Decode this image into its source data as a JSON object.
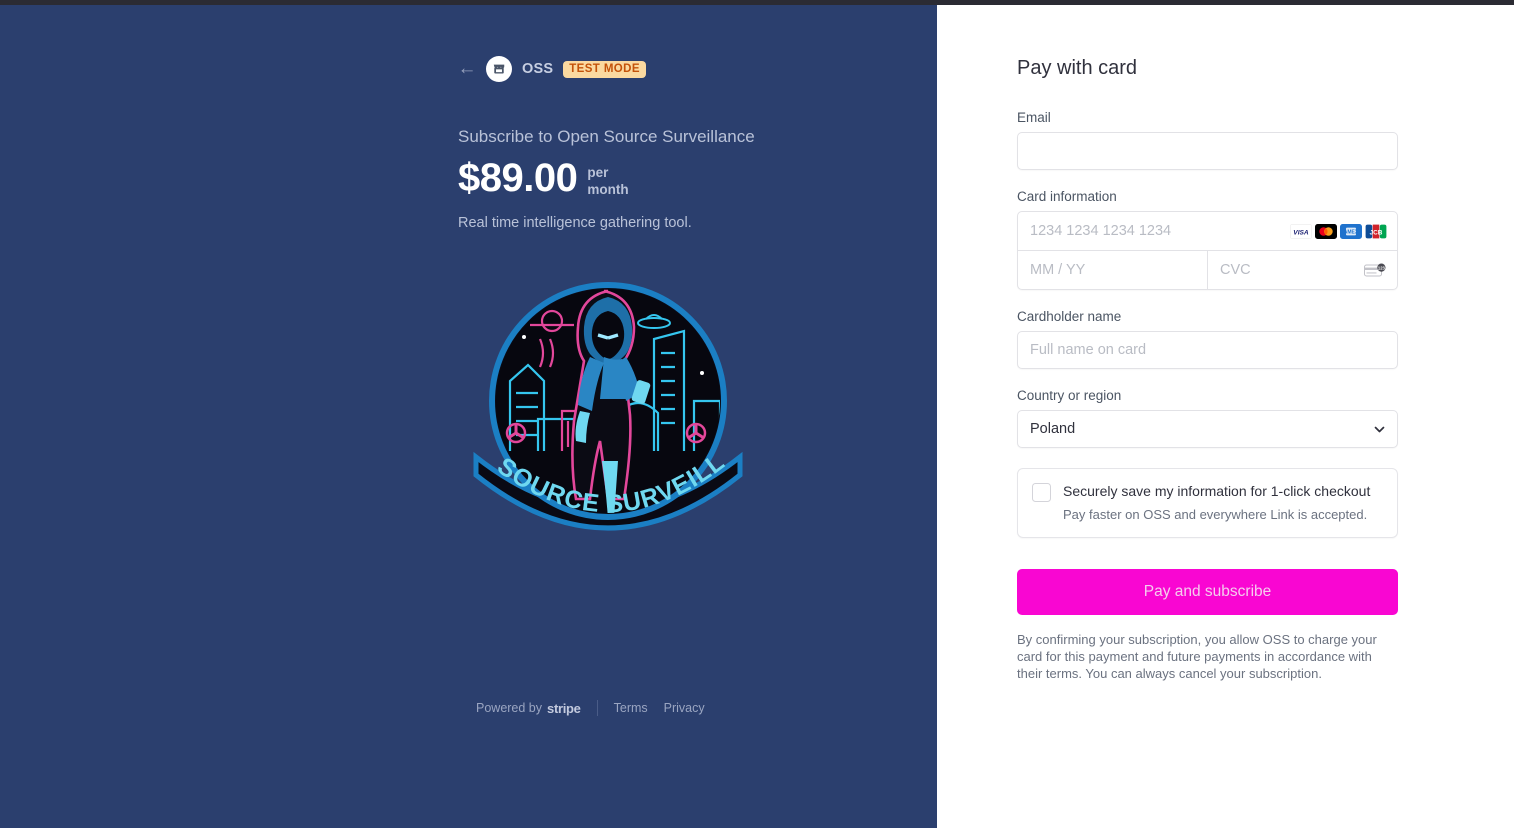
{
  "merchant": {
    "back_icon": "back-arrow-icon",
    "avatar_icon": "storefront-icon",
    "name": "OSS",
    "test_mode_badge": "TEST MODE"
  },
  "summary": {
    "subscribe_title": "Subscribe to Open Source Surveillance",
    "price": "$89.00",
    "interval_line1": "per",
    "interval_line2": "month",
    "description": "Real time intelligence gathering tool.",
    "logo_alt": "open-source-surveillance-badge",
    "logo_banner_text": "OPEN SOURCE SURVEILLANCE"
  },
  "footer": {
    "powered_by": "Powered by",
    "stripe": "stripe",
    "terms": "Terms",
    "privacy": "Privacy"
  },
  "form": {
    "title": "Pay with card",
    "email_label": "Email",
    "email_value": "",
    "email_placeholder": "",
    "card_label": "Card information",
    "card_number_placeholder": "1234 1234 1234 1234",
    "card_number_value": "",
    "expiry_placeholder": "MM / YY",
    "expiry_value": "",
    "cvc_placeholder": "CVC",
    "cvc_value": "",
    "brands": [
      "visa-icon",
      "mastercard-icon",
      "amex-icon",
      "jcb-icon"
    ],
    "cvc_hint_icon": "cvc-card-icon",
    "cardholder_label": "Cardholder name",
    "cardholder_placeholder": "Full name on card",
    "cardholder_value": "",
    "country_label": "Country or region",
    "country_value": "Poland",
    "country_options": [
      "Poland"
    ],
    "chevron_icon": "chevron-down-icon",
    "link_checkbox_checked": false,
    "link_title": "Securely save my information for 1-click checkout",
    "link_subtitle": "Pay faster on OSS and everywhere Link is accepted.",
    "pay_button": "Pay and subscribe",
    "legal": "By confirming your subscription, you allow OSS to charge your card for this payment and future payments in accordance with their terms. You can always cancel your subscription."
  },
  "colors": {
    "left_bg": "#2b3f6e",
    "pay_button": "#f906d2",
    "test_badge_bg": "#fbd9a0",
    "test_badge_fg": "#c4520a"
  }
}
